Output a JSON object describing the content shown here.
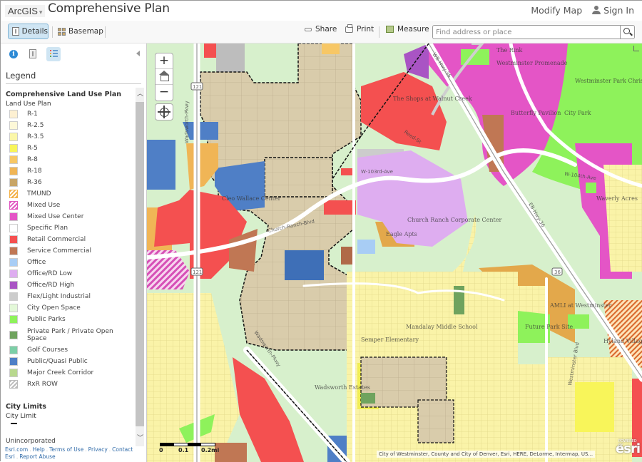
{
  "header": {
    "brand": "ArcGIS",
    "title": "Comprehensive Plan",
    "modify_map": "Modify Map",
    "sign_in": "Sign In"
  },
  "toolbar": {
    "details": "Details",
    "basemap": "Basemap",
    "share": "Share",
    "print": "Print",
    "measure": "Measure",
    "search_placeholder": "Find address or place"
  },
  "sidebar": {
    "tabs": [
      {
        "name": "about",
        "icon": "info-icon"
      },
      {
        "name": "content",
        "icon": "content-icon"
      },
      {
        "name": "legend",
        "icon": "legend-icon",
        "active": true
      }
    ],
    "legend_heading": "Legend",
    "layer_title": "Comprehensive Land Use Plan",
    "sublayer_title": "Land Use Plan",
    "items": [
      {
        "label": "R-1",
        "color": "#fdf0d2"
      },
      {
        "label": "R-2.5",
        "color": "#fdf8d8"
      },
      {
        "label": "R-3.5",
        "color": "#fbf7a8"
      },
      {
        "label": "R-5",
        "color": "#f8f55a"
      },
      {
        "label": "R-8",
        "color": "#f7c765"
      },
      {
        "label": "R-18",
        "color": "#f0b556"
      },
      {
        "label": "R-36",
        "color": "#c8a566"
      },
      {
        "label": "TMUND",
        "color": "#f3b24a",
        "pattern": "hatch"
      },
      {
        "label": "Mixed Use",
        "color": "#e055c0",
        "pattern": "hatch"
      },
      {
        "label": "Mixed Use Center",
        "color": "#e455c6"
      },
      {
        "label": "Specific Plan",
        "color": "#ffffff"
      },
      {
        "label": "Retail Commercial",
        "color": "#f45050"
      },
      {
        "label": "Service Commercial",
        "color": "#c07754"
      },
      {
        "label": "Office",
        "color": "#a8cdf5"
      },
      {
        "label": "Office/RD Low",
        "color": "#deadf0"
      },
      {
        "label": "Office/RD High",
        "color": "#a954c4"
      },
      {
        "label": "Flex/Light Industrial",
        "color": "#cccccc"
      },
      {
        "label": "City Open Space",
        "color": "#e3f8d8"
      },
      {
        "label": "Public Parks",
        "color": "#8ef25b"
      },
      {
        "label": "Private Park / Private Open Space",
        "color": "#6fa35e"
      },
      {
        "label": "Golf Courses",
        "color": "#7ccfa7"
      },
      {
        "label": "Public/Quasi Public",
        "color": "#4f7fc6"
      },
      {
        "label": "Major Creek Corridor",
        "color": "#b8d88e"
      },
      {
        "label": "RxR ROW",
        "color": "#eeeeee",
        "pattern": "hatch"
      }
    ],
    "city_limits_title": "City Limits",
    "city_limit_label": "City Limit",
    "unincorporated_label": "Unincorporated",
    "footer_links": [
      "Esri.com",
      "Help",
      "Terms of Use",
      "Privacy",
      "Contact Esri",
      "Report Abuse"
    ]
  },
  "map": {
    "zoom_in": "+",
    "zoom_out": "−",
    "scale_labels": [
      "0",
      "0.1",
      "0.2mi"
    ],
    "attribution": "City of Westminster, County and City of Denver, Esri, HERE, DeLorme, Intermap, US...",
    "esri_logo": "esri",
    "esri_powered": "POWERED BY",
    "labels": {
      "wadsworth_pkwy": "Wadsworth-Pkwy",
      "church_ranch_blvd": "Church-Ranch-Blvd",
      "w103rd": "W-103rd-Ave",
      "w104th": "W-104th-Ave",
      "wb_hwy36": "WB-Hwy-36",
      "eb_hwy36": "EB-Hwy-36",
      "reed_st": "Reed-St",
      "shield_121": "121",
      "shield_36": "36",
      "shops_walnut_creek": "The Shops at Walnut Creek",
      "cleo_wallace": "Cleo Wallace Center",
      "church_ranch_corp": "Church Ranch Corporate Center",
      "eagle_apts": "Eagle Apts",
      "waverly_acres": "Waverly Acres",
      "butterfly_pavilion": "Butterfly Pavilion",
      "city_park": "City Park",
      "mandalay_ms": "Mandalay Middle School",
      "semper_elem": "Semper Elementary",
      "amli_westminster": "AMLI at Westminster",
      "future_park": "Future Park Site",
      "hyland_village": "Hyland Village",
      "wadsworth_estates": "Wadsworth Estates",
      "westminster_blvd": "Westminster Blvd",
      "the_rink": "The Rink",
      "westminster_promenade": "Westminster Promenade",
      "westminster_park": "Westminster Park Christopher Fields"
    }
  }
}
